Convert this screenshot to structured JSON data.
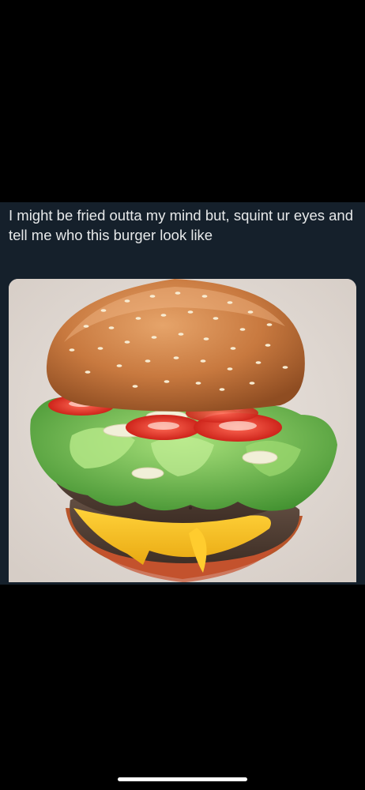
{
  "post": {
    "text": "I might be fried outta my mind but, squint ur eyes and tell me who this burger look like",
    "image_subject": "burger-photo"
  },
  "colors": {
    "background": "#000000",
    "card_background": "#15202b",
    "text": "#e7e9ea"
  },
  "system": {
    "home_indicator": "home-indicator"
  }
}
